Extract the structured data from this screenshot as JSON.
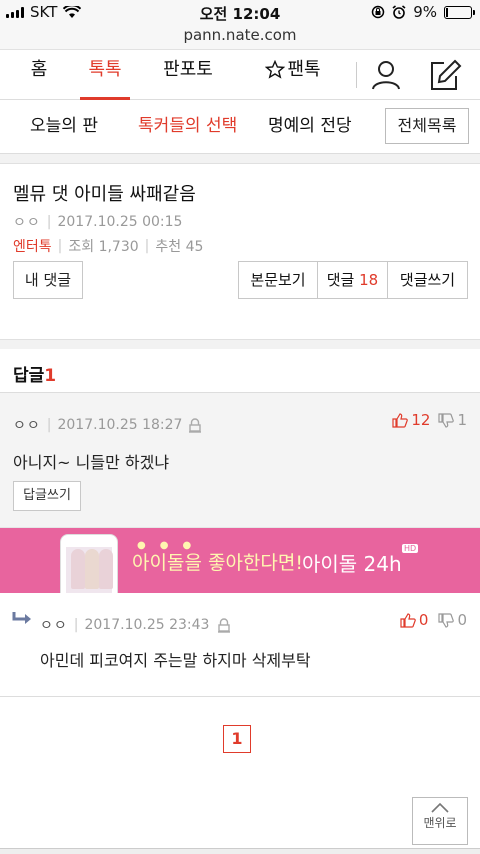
{
  "status": {
    "carrier": "SKT",
    "time": "오전 12:04",
    "battery": "9%",
    "battery_level": 0.09
  },
  "url": "pann.nate.com",
  "topnav": {
    "tabs": [
      {
        "label": "홈"
      },
      {
        "label": "톡톡"
      },
      {
        "label": "판포토"
      },
      {
        "label": "팬톡"
      }
    ],
    "star_icon": "star-outline-icon",
    "user_icon": "user-icon",
    "write_icon": "write-icon"
  },
  "subnav": {
    "items": [
      {
        "label": "오늘의 판"
      },
      {
        "label": "톡커들의 선택"
      },
      {
        "label": "명예의 전당"
      }
    ],
    "all_button": "전체목록"
  },
  "post": {
    "title": "멜뮤 댓 아미들 싸패같음",
    "author": "ㅇㅇ",
    "date": "2017.10.25 00:15",
    "category": "엔터톡",
    "views": "조회 1,730",
    "recommend": "추천 45"
  },
  "actions": {
    "my_comments": "내 댓글",
    "view_post": "본문보기",
    "comments_label": "댓글",
    "comments_count": "18",
    "write_comment": "댓글쓰기"
  },
  "replies": {
    "label": "답글",
    "count": "1"
  },
  "comment": {
    "author": "ㅇㅇ",
    "date": "2017.10.25 18:27",
    "up": "12",
    "down": "1",
    "body": "아니지~ 니들만 하겠냐",
    "reply_button": "답글쓰기"
  },
  "banner": {
    "text": "아이돌을 좋아한다면!",
    "brand": "아이돌 24h",
    "badge": "HD",
    "color": "#e8649e"
  },
  "reply": {
    "author": "ㅇㅇ",
    "date": "2017.10.25 23:43",
    "up": "0",
    "down": "0",
    "body": "아민데 피코여지 주는말 하지마 삭제부탁"
  },
  "paging": {
    "current": "1"
  },
  "to_top": "맨위로",
  "colors": {
    "accent": "#e03b2b"
  }
}
